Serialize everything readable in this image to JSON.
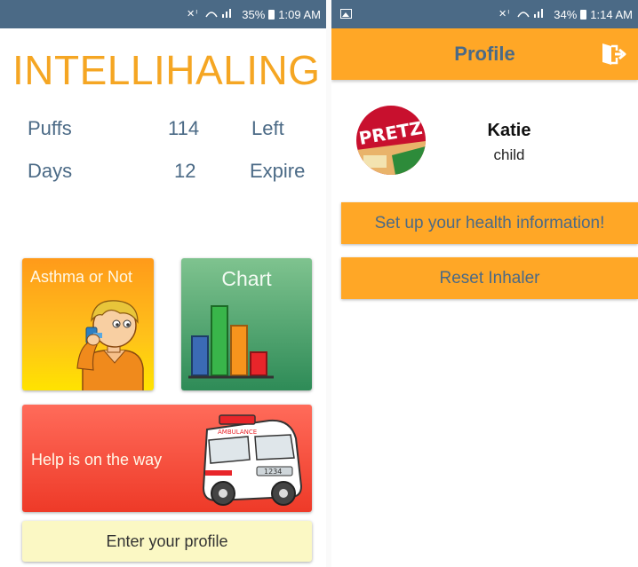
{
  "left_screen": {
    "status": {
      "icons": "¥ᴵ ≋ᵢₗₗ",
      "battery": "35%",
      "time": "1:09 AM"
    },
    "app_title": "INTELLIHALING",
    "stats": [
      {
        "label": "Puffs",
        "value": "114",
        "suffix": "Left"
      },
      {
        "label": "Days",
        "value": "12",
        "suffix": "Expire"
      }
    ],
    "tiles": {
      "asthma": "Asthma or Not",
      "chart": "Chart",
      "help": "Help is on the way",
      "profile": "Enter your profile"
    },
    "ambulance_text": "AMBULANCE",
    "ambulance_plate": "1234",
    "chart_icon_colors": [
      "#3b6bb5",
      "#39b54a",
      "#f7941d",
      "#e8252a"
    ]
  },
  "right_screen": {
    "status": {
      "icons": "¥ᴵ ≋ᵢₗₗ",
      "battery": "34%",
      "time": "1:14 AM"
    },
    "appbar_title": "Profile",
    "avatar_text": "PRETZ",
    "name": "Katie",
    "role": "child",
    "buttons": {
      "health": "Set up your health information!",
      "reset": "Reset Inhaler"
    }
  },
  "colors": {
    "status_bar": "#4b6a86",
    "accent_orange": "#ffa726",
    "title_orange": "#f5a623",
    "text_blue": "#4b6a86"
  }
}
